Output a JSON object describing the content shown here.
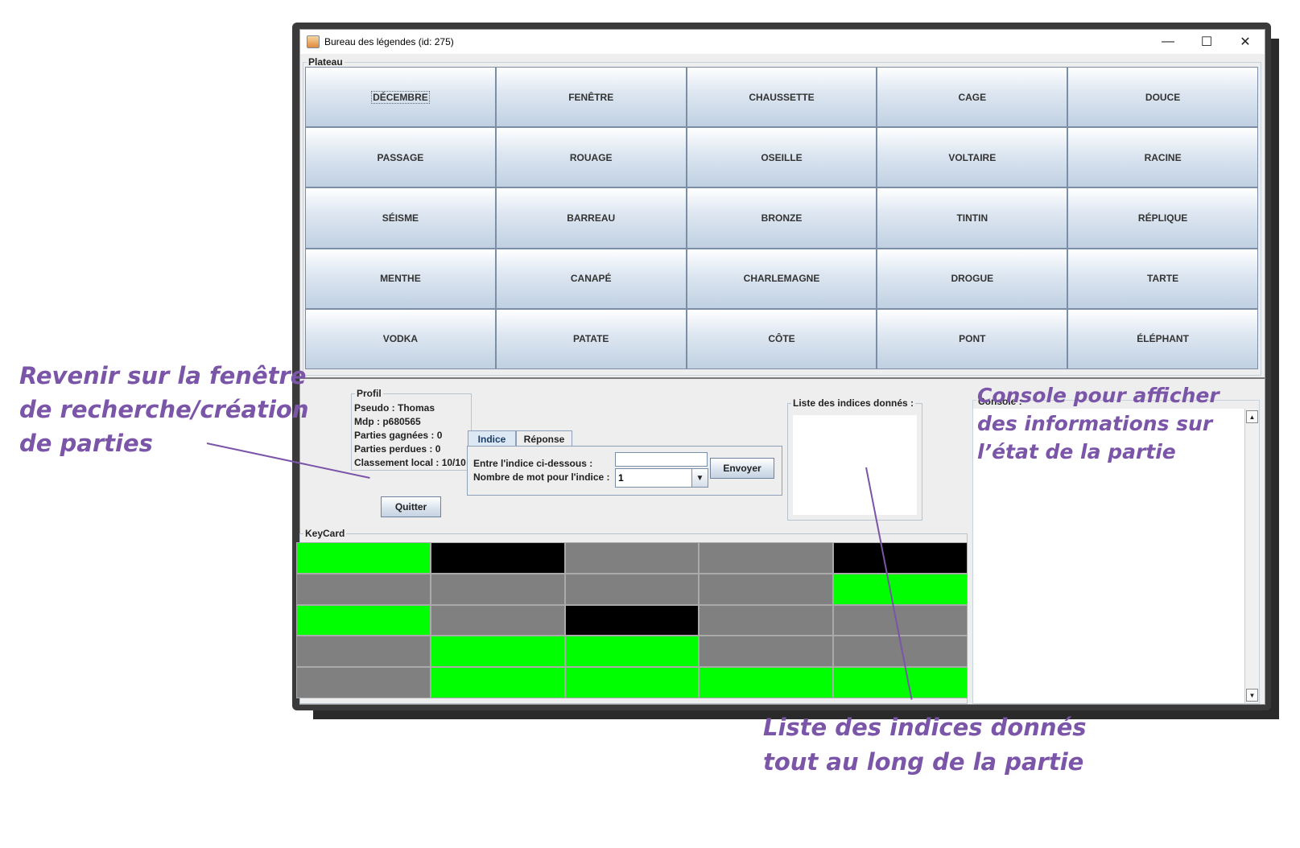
{
  "window": {
    "title": "Bureau des légendes (id: 275)",
    "controls": {
      "minimize": "—",
      "maximize": "☐",
      "close": "✕"
    }
  },
  "board": {
    "label": "Plateau",
    "words": [
      "DÉCEMBRE",
      "FENÊTRE",
      "CHAUSSETTE",
      "CAGE",
      "DOUCE",
      "PASSAGE",
      "ROUAGE",
      "OSEILLE",
      "VOLTAIRE",
      "RACINE",
      "SÉISME",
      "BARREAU",
      "BRONZE",
      "TINTIN",
      "RÉPLIQUE",
      "MENTHE",
      "CANAPÉ",
      "CHARLEMAGNE",
      "DROGUE",
      "TARTE",
      "VODKA",
      "PATATE",
      "CÔTE",
      "PONT",
      "ÉLÉPHANT"
    ]
  },
  "profile": {
    "label": "Profil",
    "pseudo": "Pseudo : Thomas",
    "mdp": "Mdp : p680565",
    "won": "Parties gagnées : 0",
    "lost": "Parties perdues : 0",
    "rank": "Classement local : 10/10"
  },
  "quit_button": "Quitter",
  "tabs": {
    "clue": "Indice",
    "answer": "Réponse"
  },
  "clue_form": {
    "clue_label": "Entre l'indice ci-dessous :",
    "clue_value": "",
    "count_label": "Nombre de mot pour l'indice :",
    "count_value": "1",
    "send_button": "Envoyer"
  },
  "hints": {
    "label": "Liste des indices donnés :"
  },
  "console": {
    "label": "Console :"
  },
  "keycard": {
    "label": "KeyCard",
    "colors": {
      "green": "#00ff00",
      "black": "#000000",
      "gray": "#808080"
    },
    "grid": [
      [
        "green",
        "black",
        "gray",
        "gray",
        "black"
      ],
      [
        "gray",
        "gray",
        "gray",
        "gray",
        "green"
      ],
      [
        "green",
        "gray",
        "black",
        "gray",
        "gray"
      ],
      [
        "gray",
        "green",
        "green",
        "gray",
        "gray"
      ],
      [
        "gray",
        "green",
        "green",
        "green",
        "green"
      ]
    ]
  },
  "annotations": {
    "left": [
      "Revenir sur la fenêtre",
      "de recherche/création",
      "de parties"
    ],
    "console": [
      "Console pour afficher",
      "des informations sur",
      "l’état de la partie"
    ],
    "bottom": [
      "Liste des indices donnés",
      "tout au long de la partie"
    ]
  }
}
